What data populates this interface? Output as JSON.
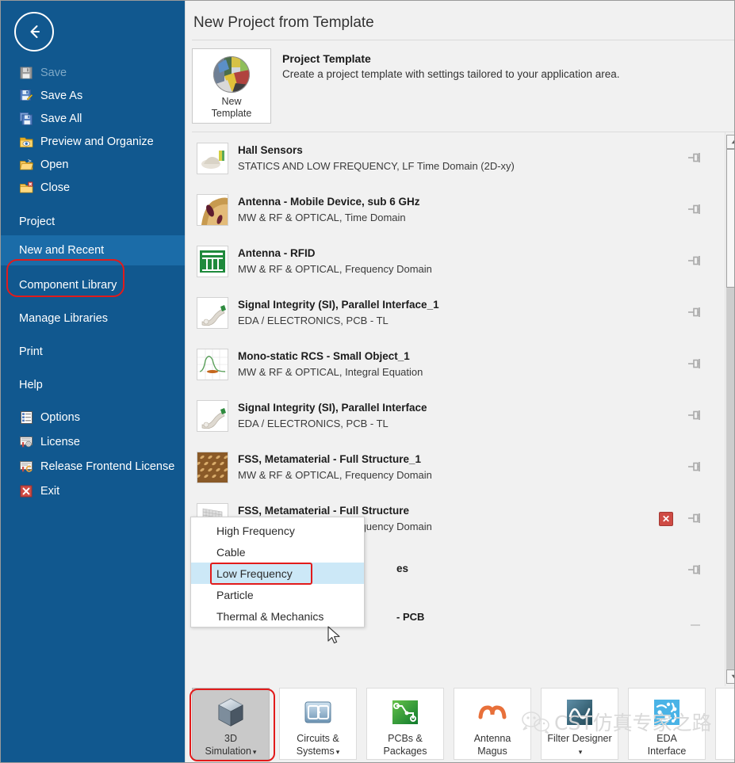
{
  "sidebar": {
    "back_icon": "back-arrow-icon",
    "items": [
      {
        "label": "Save",
        "icon": "save-icon",
        "disabled": true,
        "group": false
      },
      {
        "label": "Save As",
        "icon": "save-as-icon",
        "disabled": false,
        "group": false
      },
      {
        "label": "Save All",
        "icon": "save-all-icon",
        "disabled": false,
        "group": false
      },
      {
        "label": "Preview and Organize",
        "icon": "preview-organize-icon",
        "disabled": false,
        "group": false
      },
      {
        "label": "Open",
        "icon": "open-folder-icon",
        "disabled": false,
        "group": false
      },
      {
        "label": "Close",
        "icon": "close-folder-icon",
        "disabled": false,
        "group": false
      }
    ],
    "groups": [
      {
        "label": "Project",
        "active": false
      },
      {
        "label": "New and Recent",
        "active": true
      },
      {
        "label": "Component Library",
        "active": false
      },
      {
        "label": "Manage Libraries",
        "active": false
      },
      {
        "label": "Print",
        "active": false
      },
      {
        "label": "Help",
        "active": false
      }
    ],
    "bottom_items": [
      {
        "label": "Options",
        "icon": "options-icon"
      },
      {
        "label": "License",
        "icon": "license-icon"
      },
      {
        "label": "Release Frontend License",
        "icon": "release-license-icon"
      },
      {
        "label": "Exit",
        "icon": "exit-icon"
      }
    ]
  },
  "main": {
    "page_title": "New Project from Template",
    "template_card": {
      "button_label_line1": "New",
      "button_label_line2": "Template",
      "heading": "Project Template",
      "description": "Create a project template with settings tailored to your application area.",
      "thumb_icon": "colored-globe-icon"
    },
    "templates": [
      {
        "name": "Hall Sensors",
        "meta": "STATICS AND LOW FREQUENCY, LF Time Domain (2D-xy)",
        "thumb": "hall-sensor-thumb",
        "pin": "pin-icon",
        "delete": false
      },
      {
        "name": "Antenna - Mobile Device, sub 6 GHz",
        "meta": "MW & RF & OPTICAL, Time Domain",
        "thumb": "mobile-antenna-thumb",
        "pin": "pin-icon",
        "delete": false
      },
      {
        "name": "Antenna - RFID",
        "meta": "MW & RF & OPTICAL, Frequency Domain",
        "thumb": "rfid-antenna-thumb",
        "pin": "pin-icon",
        "delete": false
      },
      {
        "name": "Signal Integrity (SI), Parallel Interface_1",
        "meta": "EDA / ELECTRONICS, PCB - TL",
        "thumb": "signal-integrity-thumb",
        "pin": "pin-icon",
        "delete": false
      },
      {
        "name": "Mono-static RCS - Small Object_1",
        "meta": "MW & RF & OPTICAL, Integral Equation",
        "thumb": "rcs-plot-thumb",
        "pin": "pin-icon",
        "delete": false
      },
      {
        "name": "Signal Integrity (SI), Parallel Interface",
        "meta": "EDA / ELECTRONICS, PCB - TL",
        "thumb": "signal-integrity-thumb",
        "pin": "pin-icon",
        "delete": false
      },
      {
        "name": "FSS, Metamaterial - Full Structure_1",
        "meta": "MW & RF & OPTICAL, Frequency Domain",
        "thumb": "fss-copper-thumb",
        "pin": "pin-icon",
        "delete": false
      },
      {
        "name": "FSS, Metamaterial - Full Structure",
        "meta": "MW & RF & OPTICAL, Frequency Domain",
        "thumb": "fss-grey-thumb",
        "pin": "pin-icon",
        "delete": true
      },
      {
        "name": "es",
        "meta": "",
        "thumb": "hidden-thumb",
        "pin": "pin-icon",
        "delete": false
      },
      {
        "name": "",
        "meta": "- PCB",
        "thumb": "hidden-thumb",
        "pin": "pin-icon",
        "delete": false
      }
    ],
    "scrollbar": {
      "up_arrow": "scroll-up-arrow-icon",
      "down_arrow": "scroll-down-arrow-icon"
    }
  },
  "context_menu": {
    "items": [
      {
        "label": "High Frequency",
        "highlighted": false
      },
      {
        "label": "Cable",
        "highlighted": false
      },
      {
        "label": "Low Frequency",
        "highlighted": true
      },
      {
        "label": "Particle",
        "highlighted": false
      },
      {
        "label": "Thermal & Mechanics",
        "highlighted": false
      }
    ]
  },
  "app_bar": {
    "buttons": [
      {
        "line1": "3D",
        "line2": "Simulation",
        "icon": "cube-3d-icon",
        "caret": true,
        "selected": true
      },
      {
        "line1": "Circuits &",
        "line2": "Systems",
        "icon": "circuits-systems-icon",
        "caret": true,
        "selected": false
      },
      {
        "line1": "PCBs &",
        "line2": "Packages",
        "icon": "pcb-packages-icon",
        "caret": false,
        "selected": false
      },
      {
        "line1": "Antenna",
        "line2": "Magus",
        "icon": "antenna-magus-icon",
        "caret": false,
        "selected": false
      },
      {
        "line1": "Filter Designer",
        "line2": "",
        "icon": "filter-designer-icon",
        "caret": true,
        "selected": false
      },
      {
        "line1": "EDA",
        "line2": "Interface",
        "icon": "eda-interface-icon",
        "caret": false,
        "selected": false
      }
    ]
  },
  "watermark": {
    "text": "CST仿真专家之路",
    "logo": "wechat-logo-icon"
  },
  "annotations": {
    "accent_red": "#e21b1b",
    "sidebar_blue": "#11588f",
    "sidebar_active_blue": "#1b6ca8",
    "menu_highlight": "#cce8f7"
  }
}
